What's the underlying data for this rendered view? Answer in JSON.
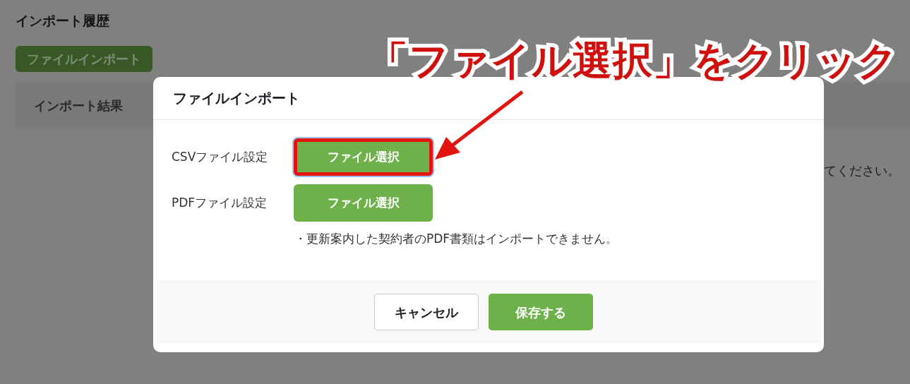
{
  "page": {
    "title": "インポート履歴",
    "import_button": "ファイルインポート",
    "table": {
      "columns": [
        "インポート結果"
      ]
    },
    "message_fragment": "てください。"
  },
  "modal": {
    "title": "ファイルインポート",
    "rows": [
      {
        "label": "CSVファイル設定",
        "button": "ファイル選択",
        "highlighted": true
      },
      {
        "label": "PDFファイル設定",
        "button": "ファイル選択",
        "highlighted": false
      }
    ],
    "note": "・更新案内した契約者のPDF書類はインポートできません。",
    "buttons": [
      {
        "label": "キャンセル",
        "kind": "secondary"
      },
      {
        "label": "保存する",
        "kind": "primary"
      }
    ]
  },
  "callout": {
    "text": "「ファイル選択」をクリック"
  }
}
